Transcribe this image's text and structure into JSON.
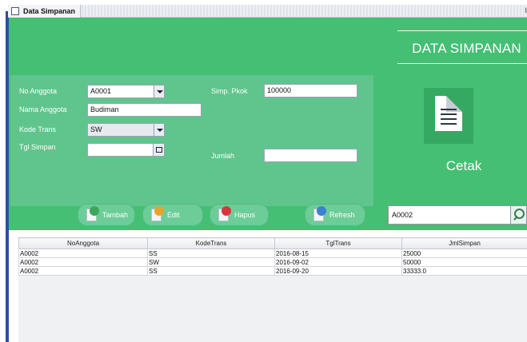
{
  "window": {
    "title": "Data Simpanan",
    "right_glyph": "I"
  },
  "header": {
    "title": "DATA SIMPANAN"
  },
  "form": {
    "no_anggota": {
      "label": "No Anggota",
      "value": "A0001"
    },
    "nama_anggota": {
      "label": "Nama Anggota",
      "value": "Budiman"
    },
    "kode_trans": {
      "label": "Kode Trans",
      "value": "SW"
    },
    "tgl_simpan": {
      "label": "Tgl Simpan",
      "value": ""
    },
    "simp_pokok": {
      "label": "Simp. Pkok",
      "value": "100000"
    },
    "jumlah": {
      "label": "Jumlah",
      "value": ""
    }
  },
  "print": {
    "label": "Cetak",
    "icon": "document-icon"
  },
  "buttons": {
    "tambah": {
      "label": "Tambah",
      "icon": "add-icon",
      "color": "#3aa858"
    },
    "edit": {
      "label": "Edit",
      "icon": "edit-icon",
      "color": "#e8a42a"
    },
    "hapus": {
      "label": "Hapus",
      "icon": "delete-icon",
      "color": "#d9343a"
    },
    "refresh": {
      "label": "Refresh",
      "icon": "refresh-icon",
      "color": "#3f7fd0"
    }
  },
  "search": {
    "value": "A0002",
    "icon": "search-icon"
  },
  "table": {
    "columns": [
      "NoAnggota",
      "KodeTrans",
      "TglTrans",
      "JmlSimpan"
    ],
    "rows": [
      [
        "A0002",
        "SS",
        "2016-08-15",
        "25000"
      ],
      [
        "A0002",
        "SW",
        "2016-09-02",
        "50000"
      ],
      [
        "A0002",
        "SS",
        "2016-09-20",
        "33333.0"
      ]
    ]
  },
  "colors": {
    "accent_green": "#44bf73",
    "panel_green": "#5fc58c",
    "left_bar": "#2b4f9e"
  }
}
